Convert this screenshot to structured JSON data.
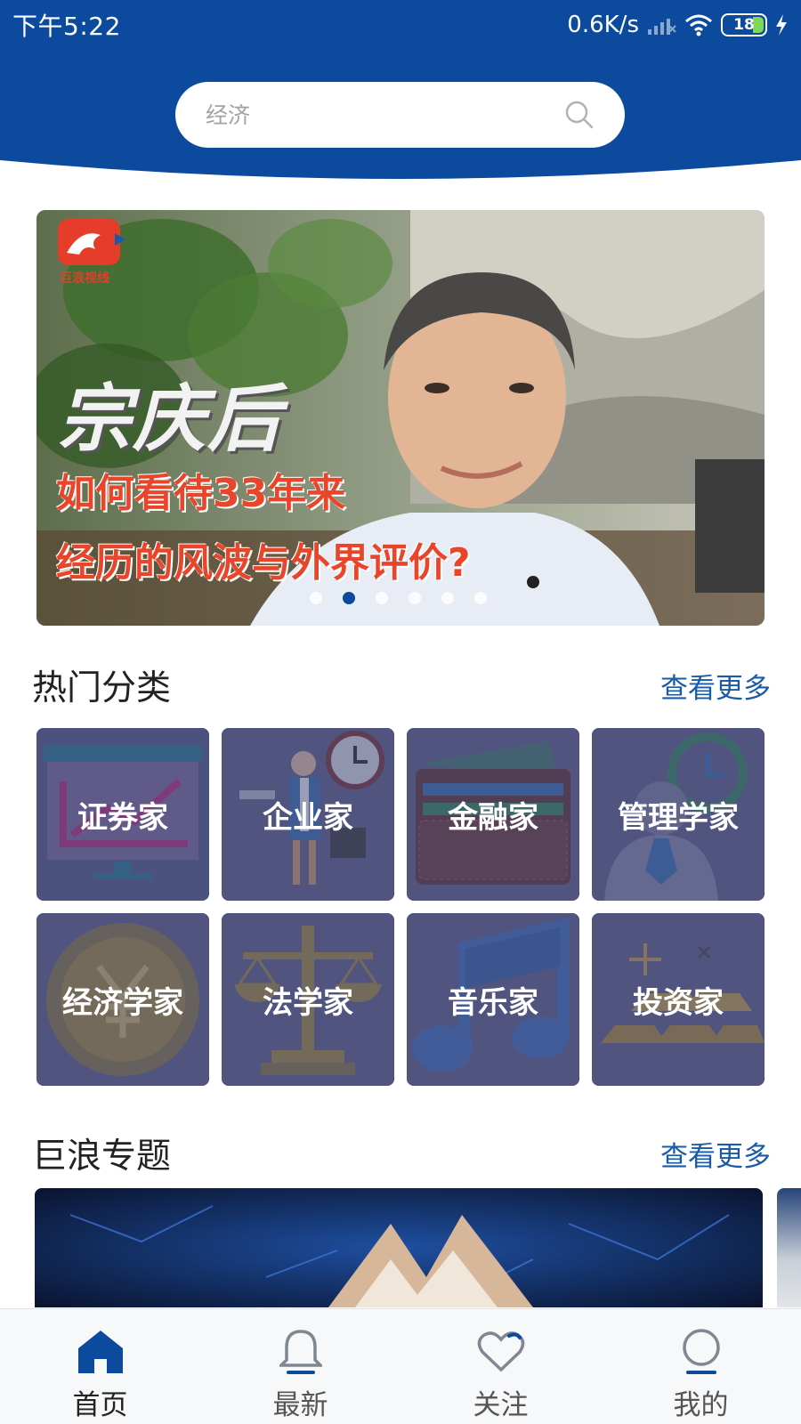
{
  "status_bar": {
    "time": "下午5:22",
    "net_speed": "0.6K/s",
    "battery": "18"
  },
  "search": {
    "placeholder": "经济"
  },
  "banner": {
    "logo_text": "巨浪视线",
    "title": "宗庆后",
    "subtitle_line1": "如何看待33年来",
    "subtitle_line2": "经历的风波与外界评价?",
    "dot_count": 6,
    "active_dot": 1
  },
  "hot_categories": {
    "title": "热门分类",
    "more": "查看更多",
    "items": [
      {
        "label": "证券家"
      },
      {
        "label": "企业家"
      },
      {
        "label": "金融家"
      },
      {
        "label": "管理学家"
      },
      {
        "label": "经济学家"
      },
      {
        "label": "法学家"
      },
      {
        "label": "音乐家"
      },
      {
        "label": "投资家"
      }
    ]
  },
  "topics": {
    "title": "巨浪专题",
    "more": "查看更多"
  },
  "bottom_nav": {
    "items": [
      {
        "label": "首页",
        "icon": "home-icon",
        "active": true
      },
      {
        "label": "最新",
        "icon": "bell-icon",
        "active": false
      },
      {
        "label": "关注",
        "icon": "heart-icon",
        "active": false
      },
      {
        "label": "我的",
        "icon": "user-icon",
        "active": false
      }
    ]
  },
  "colors": {
    "brand_blue": "#0b4a9c",
    "link_blue": "#1a5aa6",
    "banner_red": "#e8452a"
  }
}
